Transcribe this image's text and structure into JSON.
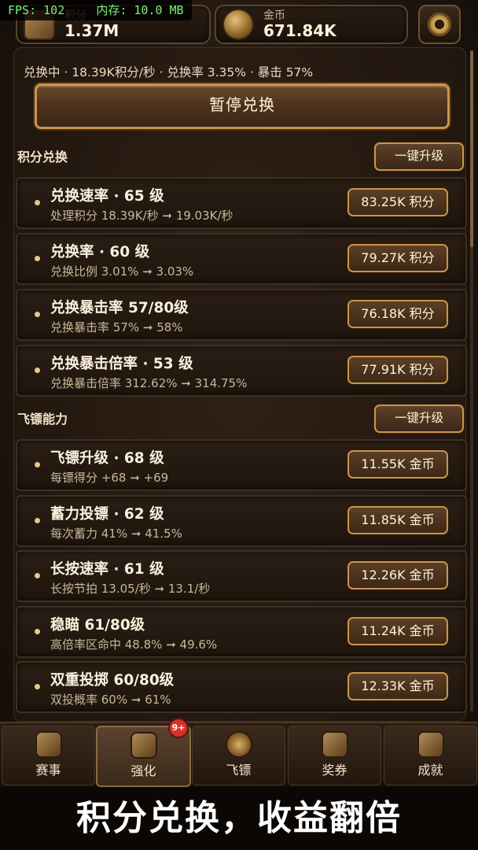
{
  "debug": {
    "fps": "FPS: 102",
    "memory": "内存: 10.0 MB"
  },
  "resources": [
    {
      "label": "积分",
      "value": "1.37M",
      "icon": "scroll-icon"
    },
    {
      "label": "金币",
      "value": "671.84K",
      "icon": "coin-icon"
    }
  ],
  "settings_icon": "gear-icon",
  "status_line": "兑换中 · 18.39K积分/秒 · 兑换率 3.35% · 暴击 57%",
  "pause_button": "暂停兑换",
  "sections": [
    {
      "title": "积分兑换",
      "upgrade_all": "一键升级",
      "items": [
        {
          "title": "兑换速率 · 65 级",
          "sub": "处理积分 18.39K/秒 ➞ 19.03K/秒",
          "cost": "83.25K 积分"
        },
        {
          "title": "兑换率 · 60 级",
          "sub": "兑换比例 3.01% ➞ 3.03%",
          "cost": "79.27K 积分"
        },
        {
          "title": "兑换暴击率 57/80级",
          "sub": "兑换暴击率 57% ➞ 58%",
          "cost": "76.18K 积分"
        },
        {
          "title": "兑换暴击倍率 · 53 级",
          "sub": "兑换暴击倍率 312.62% ➞ 314.75%",
          "cost": "77.91K 积分"
        }
      ]
    },
    {
      "title": "飞镖能力",
      "upgrade_all": "一键升级",
      "items": [
        {
          "title": "飞镖升级 · 68 级",
          "sub": "每镖得分 +68 ➞ +69",
          "cost": "11.55K 金币"
        },
        {
          "title": "蓄力投镖 · 62 级",
          "sub": "每次蓄力 41% ➞ 41.5%",
          "cost": "11.85K 金币"
        },
        {
          "title": "长按速率 · 61 级",
          "sub": "长按节拍 13.05/秒 ➞ 13.1/秒",
          "cost": "12.26K 金币"
        },
        {
          "title": "稳瞄 61/80级",
          "sub": "高倍率区命中 48.8% ➞ 49.6%",
          "cost": "11.24K 金币"
        },
        {
          "title": "双重投掷 60/80级",
          "sub": "双投概率 60% ➞ 61%",
          "cost": "12.33K 金币"
        }
      ]
    }
  ],
  "tabs": [
    {
      "label": "赛事",
      "icon": "trophy-icon",
      "active": false
    },
    {
      "label": "强化",
      "icon": "upgrade-icon",
      "active": true
    },
    {
      "label": "飞镖",
      "icon": "dart-icon",
      "active": false
    },
    {
      "label": "奖券",
      "icon": "ticket-icon",
      "active": false
    },
    {
      "label": "成就",
      "icon": "achievement-icon",
      "active": false
    }
  ],
  "tab_badge": "9+",
  "banner": "积分兑换，收益翻倍"
}
